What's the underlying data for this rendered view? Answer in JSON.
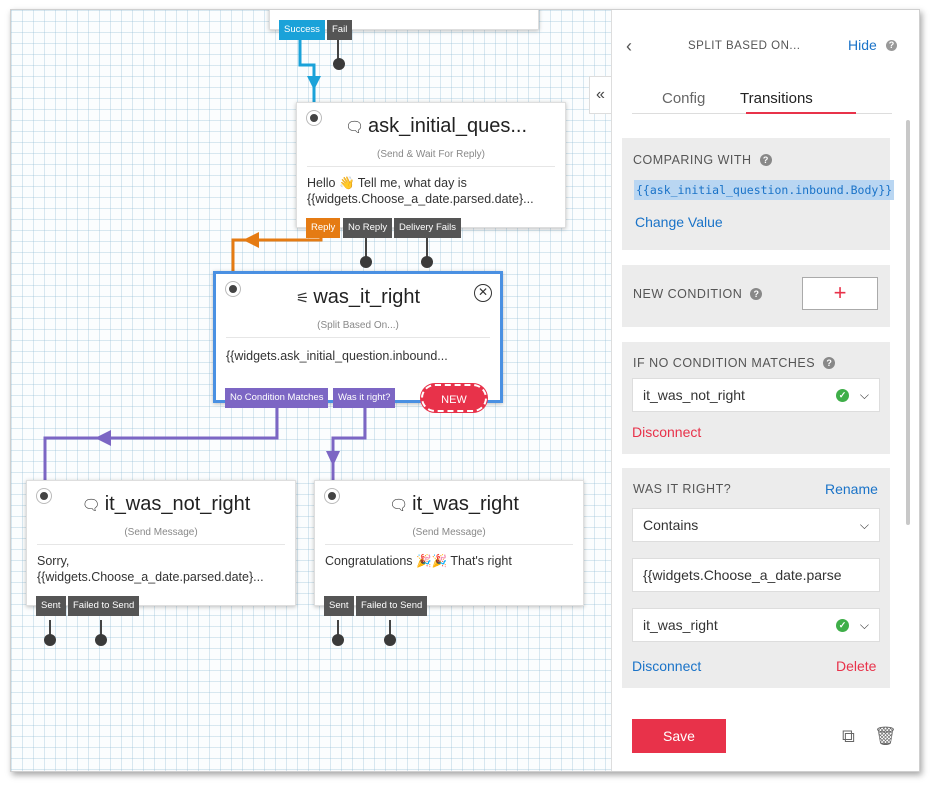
{
  "colors": {
    "selected_border": "#4a90e2",
    "success_wire": "#1aa2d9",
    "reply_wire": "#e57b13",
    "condition_wire": "#7c66c4",
    "accent_red": "#e8324a",
    "link_blue": "#1a73c8",
    "check_green": "#3fae49"
  },
  "canvas": {
    "top_widget": {
      "transitions": [
        "Success",
        "Fail"
      ]
    },
    "nodes": {
      "ask": {
        "icon": "chat-bubble-icon",
        "title": "ask_initial_ques...",
        "type": "(Send & Wait For Reply)",
        "body_1": "Hello 👋 Tell me, what day is",
        "body_2": "{{widgets.Choose_a_date.parsed.date}...",
        "transitions": [
          "Reply",
          "No Reply",
          "Delivery Fails"
        ]
      },
      "split": {
        "icon": "split-icon",
        "title": "was_it_right",
        "type": "(Split Based On...)",
        "body": "{{widgets.ask_initial_question.inbound...",
        "transitions": [
          "No Condition Matches",
          "Was it right?"
        ],
        "new_label": "NEW"
      },
      "not_right": {
        "icon": "chat-bubble-icon",
        "title": "it_was_not_right",
        "type": "(Send Message)",
        "body_1": "Sorry,",
        "body_2": "{{widgets.Choose_a_date.parsed.date}...",
        "transitions": [
          "Sent",
          "Failed to Send"
        ]
      },
      "right": {
        "icon": "chat-bubble-icon",
        "title": "it_was_right",
        "type": "(Send Message)",
        "body": "Congratulations 🎉🎉 That's right",
        "transitions": [
          "Sent",
          "Failed to Send"
        ]
      }
    },
    "collapse_glyph": "«"
  },
  "panel": {
    "back_icon": "chevron-left-icon",
    "title": "SPLIT BASED ON...",
    "hide": "Hide",
    "tabs": [
      "Config",
      "Transitions"
    ],
    "active_tab": "Transitions",
    "comparing": {
      "label": "COMPARING WITH",
      "value": "{{ask_initial_question.inbound.Body}}",
      "change": "Change Value"
    },
    "new_condition": {
      "label": "NEW CONDITION",
      "button": "+"
    },
    "no_match": {
      "label": "IF NO CONDITION MATCHES",
      "selected": "it_was_not_right",
      "disconnect": "Disconnect"
    },
    "condition": {
      "label": "WAS IT RIGHT?",
      "rename": "Rename",
      "operator": "Contains",
      "value": "{{widgets.Choose_a_date.parse",
      "target": "it_was_right",
      "disconnect": "Disconnect",
      "delete": "Delete"
    },
    "save": "Save"
  }
}
